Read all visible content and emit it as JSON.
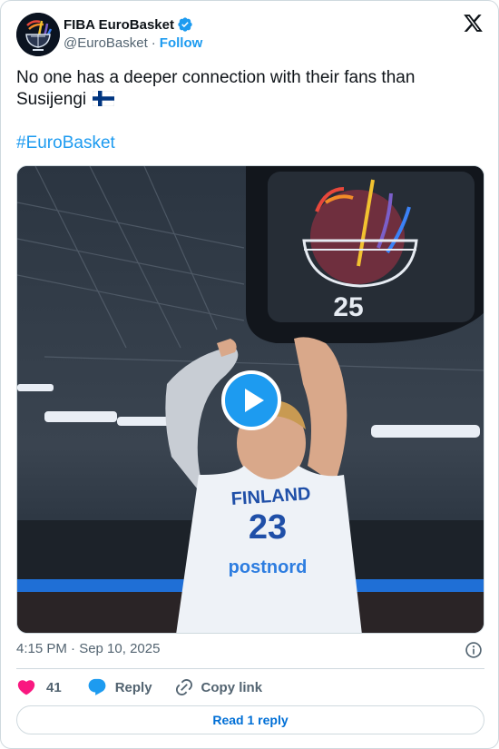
{
  "author": {
    "display_name": "FIBA EuroBasket",
    "handle": "@EuroBasket",
    "separator": "·",
    "follow_label": "Follow",
    "verified_color": "#1d9bf0"
  },
  "tweet": {
    "text": "No one has a deeper connection with their fans than Susijengi",
    "flag": "finland-flag-icon",
    "hashtag": "#EuroBasket",
    "timestamp": "4:15 PM · Sep 10, 2025"
  },
  "media": {
    "type": "video",
    "jersey_text": "FINLAND",
    "jersey_number": "23",
    "jersey_sponsor": "postnord",
    "scoreboard_logo_text": "25"
  },
  "actions": {
    "like_count": "41",
    "reply_label": "Reply",
    "copy_label": "Copy link"
  },
  "footer": {
    "read_replies_label": "Read 1 reply"
  },
  "colors": {
    "accent": "#1d9bf0",
    "like": "#f91880",
    "secondary_text": "#536471",
    "border": "#cfd9de"
  }
}
